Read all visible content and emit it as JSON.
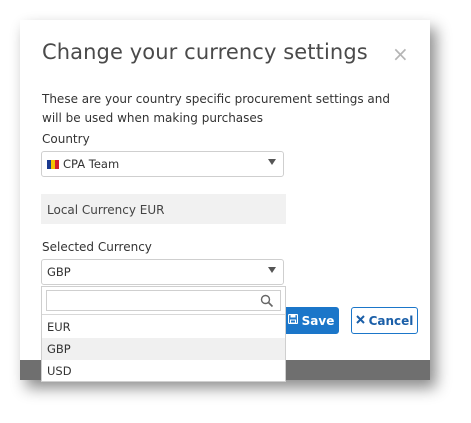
{
  "dialog": {
    "title": "Change your currency settings",
    "close_glyph": "×",
    "description": "These are your country specific procurement settings and will be used when making purchases"
  },
  "country": {
    "label": "Country",
    "value": "CPA Team",
    "flag_icon": "flag-icon"
  },
  "local_currency": {
    "text": "Local Currency EUR"
  },
  "selected_currency": {
    "label": "Selected Currency",
    "value": "GBP",
    "search_placeholder": "",
    "options": [
      "EUR",
      "GBP",
      "USD"
    ],
    "highlighted": "GBP"
  },
  "buttons": {
    "save_label": "Save",
    "cancel_label": "Cancel"
  },
  "colors": {
    "primary": "#1b76c9",
    "muted_bg": "#f1f1f1",
    "strip": "#6f6f6f"
  }
}
